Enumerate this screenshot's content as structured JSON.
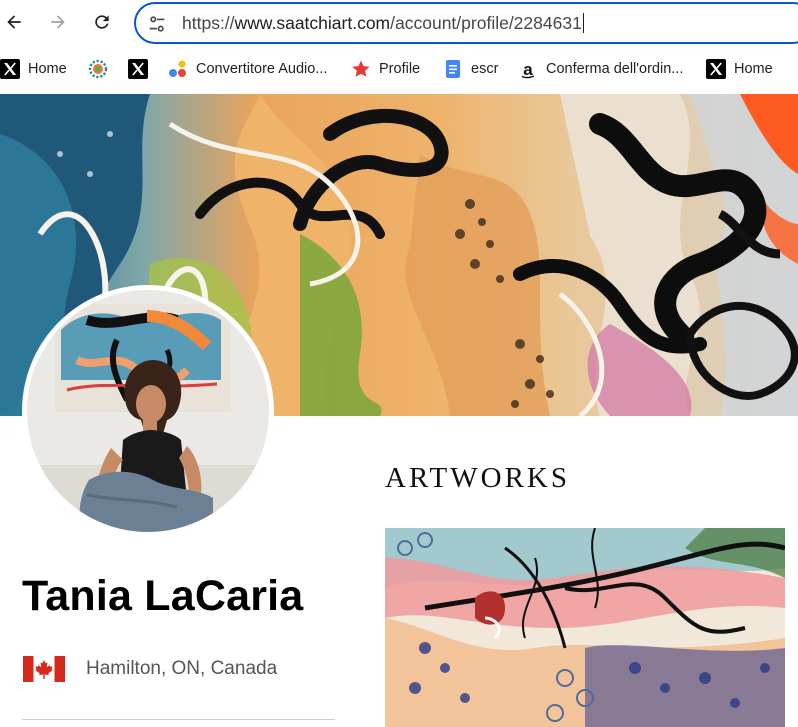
{
  "browser": {
    "url_prefix": "https://",
    "url_host": "www.saatchiart.com",
    "url_path": "/account/profile/2284631",
    "bookmarks": [
      {
        "label": "Home",
        "icon": "x-icon"
      },
      {
        "label": "",
        "icon": "gear-flower-icon"
      },
      {
        "label": "",
        "icon": "x-icon"
      },
      {
        "label": "Convertitore Audio...",
        "icon": "dots-icon"
      },
      {
        "label": "Profile",
        "icon": "star-icon"
      },
      {
        "label": "escr",
        "icon": "docs-icon"
      },
      {
        "label": "Conferma dell'ordin...",
        "icon": "a-icon"
      },
      {
        "label": "Home",
        "icon": "x-icon"
      }
    ]
  },
  "profile": {
    "name": "Tania LaCaria",
    "location": "Hamilton, ON, Canada"
  },
  "artworks": {
    "title": "ARTWORKS"
  },
  "colors": {
    "accent": "#0b57d0",
    "flag_red": "#d52b1e"
  }
}
